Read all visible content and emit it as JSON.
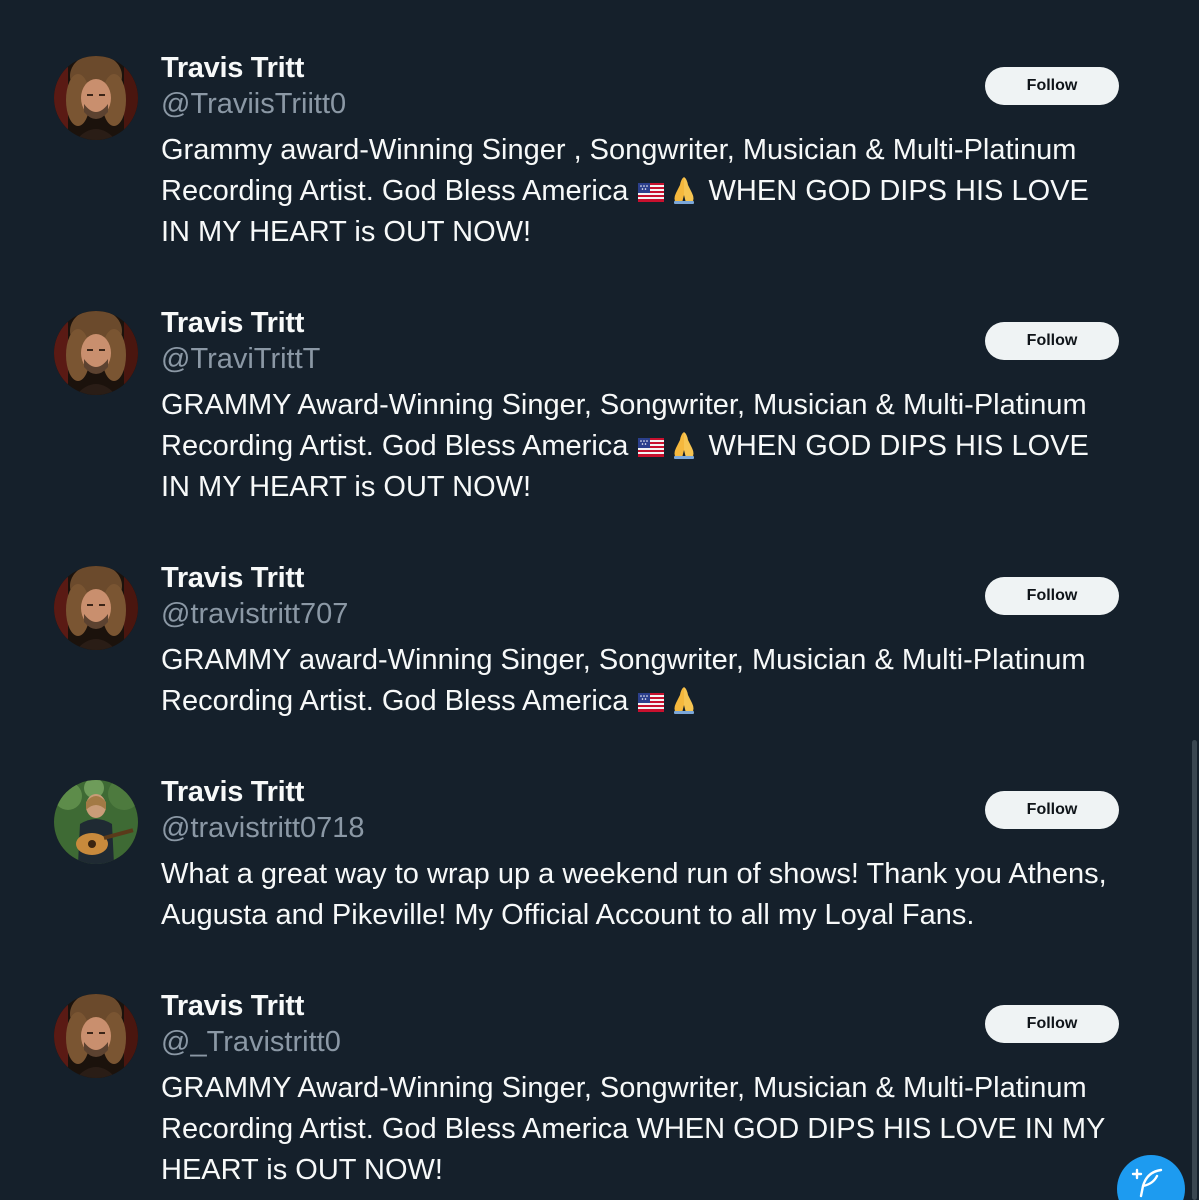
{
  "follow_label": "Follow",
  "accent_color": "#1d9bf0",
  "background_color": "#15202b",
  "users": [
    {
      "name": "Travis Tritt",
      "handle": "@TraviisTriitt0",
      "bio_parts": [
        "Grammy award-Winning Singer , Songwriter, Musician & Multi-Platinum Recording Artist. God Bless America ",
        {
          "emoji": "us-flag-icon"
        },
        {
          "emoji": "praying-hands-icon"
        },
        " WHEN GOD DIPS HIS LOVE IN MY HEART is OUT NOW!"
      ],
      "avatar": "portrait-dark"
    },
    {
      "name": "Travis Tritt",
      "handle": "@TraviTrittT",
      "avatar": "portrait-dark"
    },
    {
      "name": "Travis Tritt",
      "handle": "@travistritt707",
      "avatar": "portrait-dark"
    },
    {
      "name": "Travis Tritt",
      "handle": "@travistritt0718",
      "avatar": "guitar-outdoor"
    },
    {
      "name": "Travis Tritt",
      "handle": "@_Travistritt0",
      "avatar": "portrait-dark"
    }
  ],
  "bios": {
    "u1_a": "Grammy award-Winning Singer , Songwriter, Musician & Multi-Platinum Recording Artist. God Bless America",
    "u1_b": "WHEN GOD DIPS HIS LOVE IN MY HEART is OUT NOW!",
    "u2_a": "GRAMMY Award-Winning Singer, Songwriter, Musician & Multi-Platinum Recording Artist. God Bless America",
    "u2_b": "WHEN GOD DIPS HIS LOVE IN MY HEART is OUT NOW!",
    "u3_a": "GRAMMY award-Winning Singer, Songwriter, Musician & Multi-Platinum Recording Artist. God Bless America",
    "u4": "What a great way to wrap up a weekend run of shows! Thank you Athens, Augusta and Pikeville! My Official Account to all my Loyal Fans.",
    "u5": "GRAMMY Award-Winning Singer, Songwriter, Musician & Multi-Platinum Recording Artist. God Bless America WHEN GOD DIPS HIS LOVE IN MY HEART is OUT NOW!"
  },
  "icons": {
    "compose": "feather-plus-icon",
    "flag": "us-flag-icon",
    "pray": "praying-hands-icon"
  }
}
